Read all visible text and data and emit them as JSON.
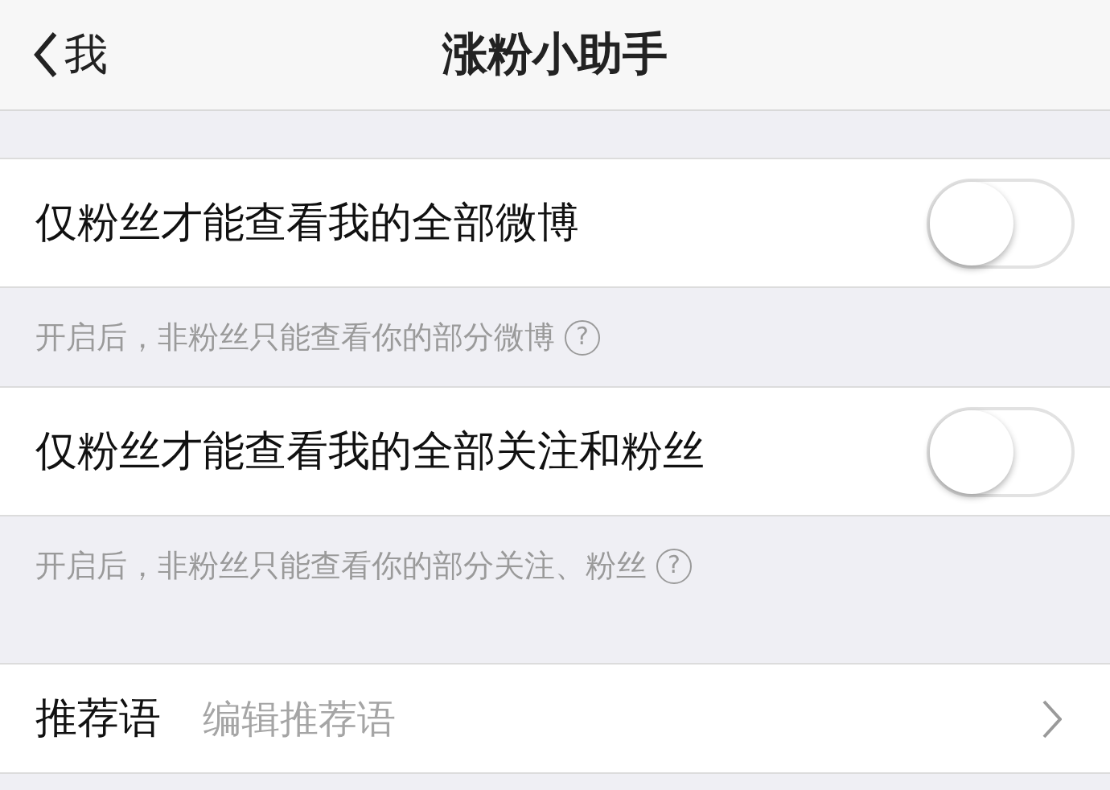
{
  "nav": {
    "back_label": "我",
    "title": "涨粉小助手"
  },
  "settings": [
    {
      "label": "仅粉丝才能查看我的全部微博",
      "on": false,
      "hint": "开启后，非粉丝只能查看你的部分微博",
      "help_icon": "?"
    },
    {
      "label": "仅粉丝才能查看我的全部关注和粉丝",
      "on": false,
      "hint": "开启后，非粉丝只能查看你的部分关注、粉丝",
      "help_icon": "?"
    }
  ],
  "recommend": {
    "label": "推荐语",
    "placeholder": "编辑推荐语"
  }
}
